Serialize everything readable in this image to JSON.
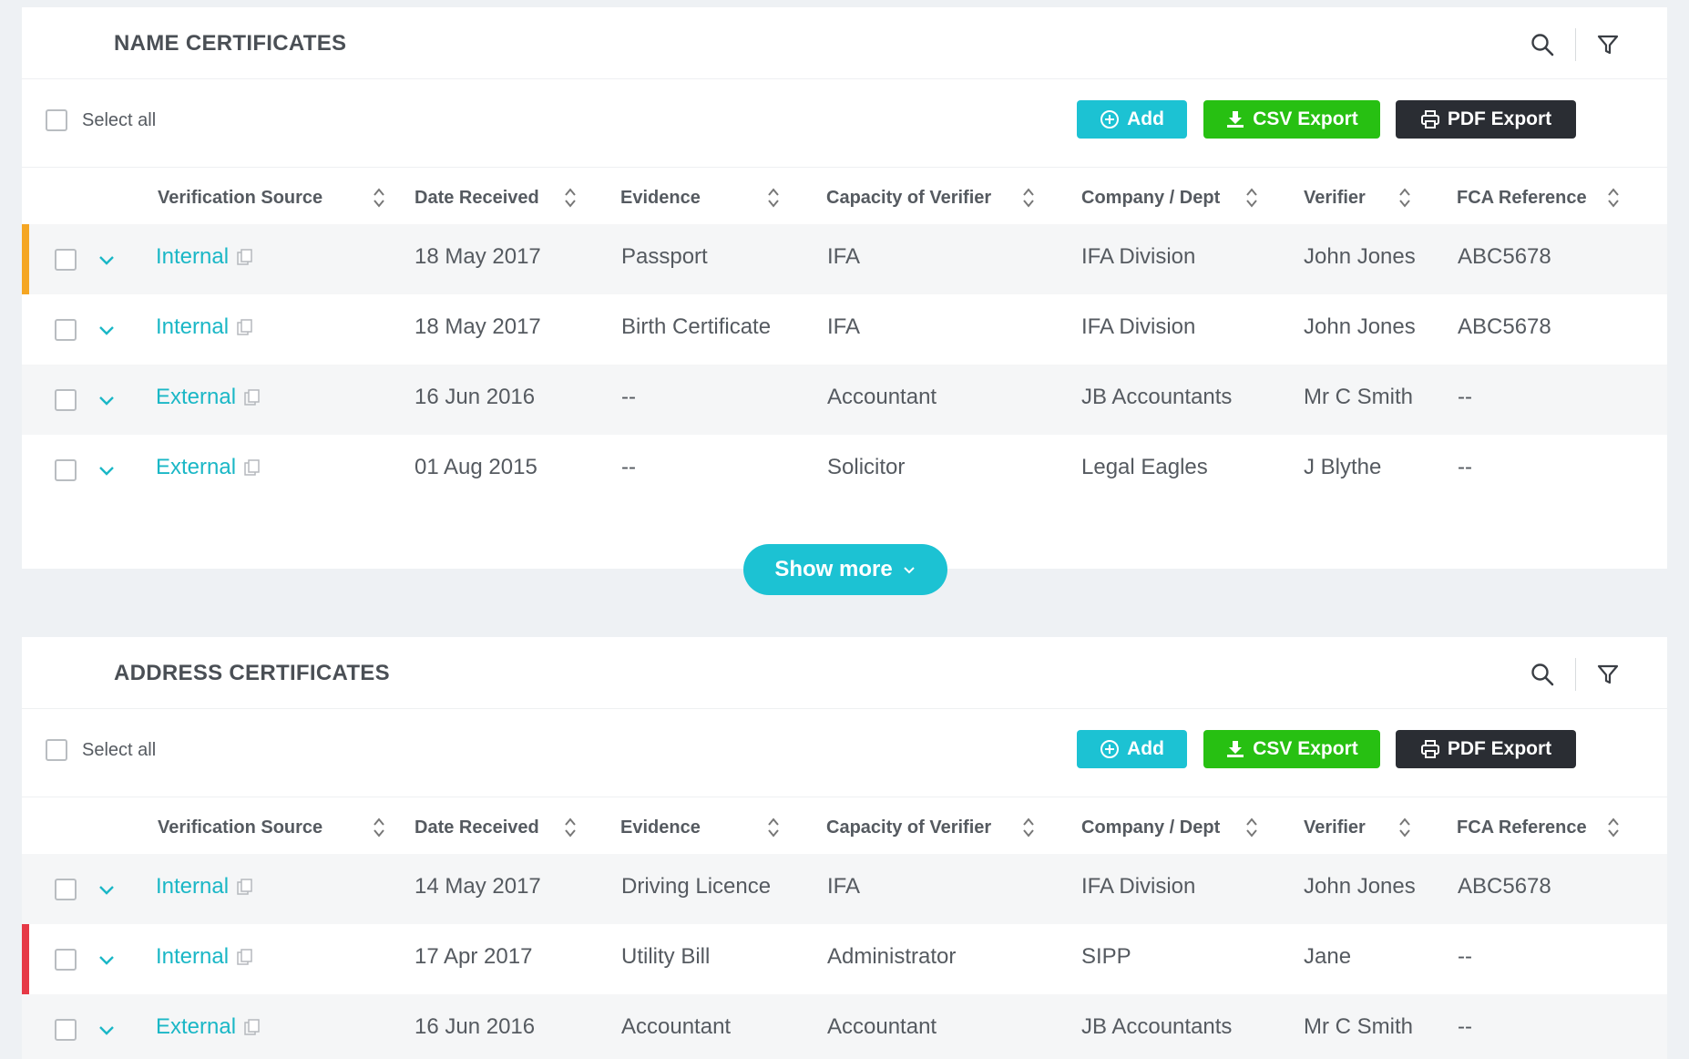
{
  "colors": {
    "accent": "#1cc2d3",
    "csv": "#27c012",
    "pdf": "#2a2d33",
    "flag_orange": "#f5a623",
    "flag_red": "#e63946",
    "link": "#1ab7c6"
  },
  "name_section": {
    "title": "NAME CERTIFICATES",
    "select_all": "Select all",
    "buttons": {
      "add": "Add",
      "csv": "CSV Export",
      "pdf": "PDF Export"
    },
    "columns": [
      "Verification Source",
      "Date Received",
      "Evidence",
      "Capacity of Verifier",
      "Company / Dept",
      "Verifier",
      "FCA Reference"
    ],
    "rows": [
      {
        "source": "Internal",
        "date": "18 May 2017",
        "evidence": "Passport",
        "capacity": "IFA",
        "company": "IFA Division",
        "verifier": "John Jones",
        "fca": "ABC5678",
        "flag": "orange"
      },
      {
        "source": "Internal",
        "date": "18 May 2017",
        "evidence": "Birth Certificate",
        "capacity": "IFA",
        "company": "IFA Division",
        "verifier": "John Jones",
        "fca": "ABC5678",
        "flag": ""
      },
      {
        "source": "External",
        "date": "16 Jun 2016",
        "evidence": "--",
        "capacity": "Accountant",
        "company": "JB Accountants",
        "verifier": "Mr C Smith",
        "fca": "--",
        "flag": ""
      },
      {
        "source": "External",
        "date": "01 Aug 2015",
        "evidence": "--",
        "capacity": "Solicitor",
        "company": "Legal Eagles",
        "verifier": "J Blythe",
        "fca": "--",
        "flag": ""
      }
    ],
    "show_more": "Show more"
  },
  "address_section": {
    "title": "ADDRESS CERTIFICATES",
    "select_all": "Select all",
    "buttons": {
      "add": "Add",
      "csv": "CSV Export",
      "pdf": "PDF Export"
    },
    "columns": [
      "Verification Source",
      "Date Received",
      "Evidence",
      "Capacity of Verifier",
      "Company / Dept",
      "Verifier",
      "FCA Reference"
    ],
    "rows": [
      {
        "source": "Internal",
        "date": "14 May 2017",
        "evidence": "Driving Licence",
        "capacity": "IFA",
        "company": "IFA Division",
        "verifier": "John Jones",
        "fca": "ABC5678",
        "flag": ""
      },
      {
        "source": "Internal",
        "date": "17 Apr 2017",
        "evidence": "Utility Bill",
        "capacity": "Administrator",
        "company": "SIPP",
        "verifier": "Jane",
        "fca": "--",
        "flag": "red"
      },
      {
        "source": "External",
        "date": "16 Jun 2016",
        "evidence": "Accountant",
        "capacity": "Accountant",
        "company": "JB Accountants",
        "verifier": "Mr C Smith",
        "fca": "--",
        "flag": ""
      }
    ]
  }
}
